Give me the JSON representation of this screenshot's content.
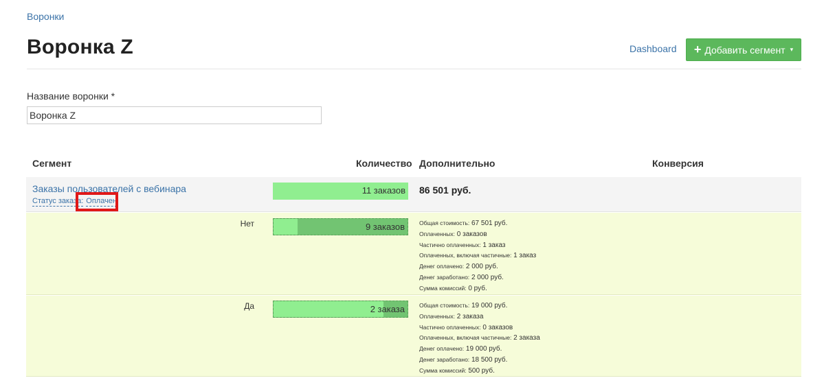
{
  "breadcrumb": "Воронки",
  "title": "Воронка Z",
  "dashboard_link": "Dashboard",
  "add_button": {
    "icon": "plus-icon",
    "label": "Добавить сегмент",
    "caret": "▾"
  },
  "form": {
    "label": "Название воронки *",
    "value": "Воронка Z"
  },
  "table": {
    "headers": {
      "segment": "Сегмент",
      "count": "Количество",
      "extra": "Дополнительно",
      "conversion": "Конверсия"
    },
    "segment": {
      "name": "Заказы пользователей с вебинара",
      "condition_key": "Статус заказа:",
      "condition_value": "Оплачен",
      "count_text": "11 заказов",
      "total": "86 501 руб."
    },
    "subrows": [
      {
        "label": "Нет",
        "count_text": "9 заказов",
        "fill_fraction": 0.18,
        "details": [
          {
            "k": "Общая стоимость:",
            "v": " 67 501 руб."
          },
          {
            "k": "Оплаченных:",
            "v": " 0 заказов"
          },
          {
            "k": "Частично оплаченных:",
            "v": " 1 заказ"
          },
          {
            "k": "Оплаченных, включая частичные:",
            "v": " 1 заказ"
          },
          {
            "k": "Денег оплачено:",
            "v": " 2 000 руб."
          },
          {
            "k": "Денег заработано:",
            "v": " 2 000 руб."
          },
          {
            "k": "Сумма комиссий:",
            "v": " 0 руб."
          }
        ]
      },
      {
        "label": "Да",
        "count_text": "2 заказа",
        "fill_fraction": 0.82,
        "details": [
          {
            "k": "Общая стоимость:",
            "v": " 19 000 руб."
          },
          {
            "k": "Оплаченных:",
            "v": " 2 заказа"
          },
          {
            "k": "Частично оплаченных:",
            "v": " 0 заказов"
          },
          {
            "k": "Оплаченных, включая частичные:",
            "v": " 2 заказа"
          },
          {
            "k": "Денег оплачено:",
            "v": " 19 000 руб."
          },
          {
            "k": "Денег заработано:",
            "v": " 18 500 руб."
          },
          {
            "k": "Сумма комиссий:",
            "v": " 500 руб."
          }
        ]
      }
    ]
  },
  "colors": {
    "link": "#3b73a8",
    "bar_light": "#90ee90",
    "bar_dark": "#72c472",
    "button": "#5cb85c",
    "subrow_bg": "#f6fcd9",
    "highlight": "#e01818"
  }
}
